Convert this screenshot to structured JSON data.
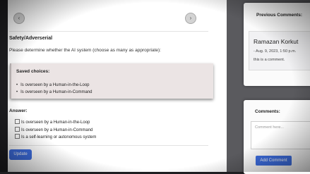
{
  "navigation": {
    "prev_icon": "chevron-left-icon",
    "next_icon": "chevron-right-icon",
    "prev_glyph": "‹",
    "next_glyph": "›"
  },
  "question": {
    "section": "Safety/Adverserial",
    "prompt": "Please determine whether the AI system (choose as many as appropriate):"
  },
  "saved": {
    "title": "Saved choices:",
    "items": [
      "Is overseen by a Human-in-the-Loop",
      "Is overseen by a Human-in-Command"
    ]
  },
  "answer": {
    "title": "Answer:",
    "options": [
      "Is overseen by a Human-in-the-Loop",
      "Is overseen by a Human-in-Command",
      "Is a self-learning or autonomous system"
    ],
    "update_label": "Update"
  },
  "previous_comments": {
    "title": "Previous Comments:",
    "items": [
      {
        "author": "Ramazan Korkut",
        "date": "- Aug. 9, 2023, 1:50 p.m.",
        "text": "this is a comment."
      }
    ]
  },
  "new_comment": {
    "title": "Comments:",
    "placeholder": "Comment here...",
    "button_label": "Add Comment"
  },
  "colors": {
    "primary_button": "#3e6ee0",
    "saved_box": "#ebe4e4"
  }
}
